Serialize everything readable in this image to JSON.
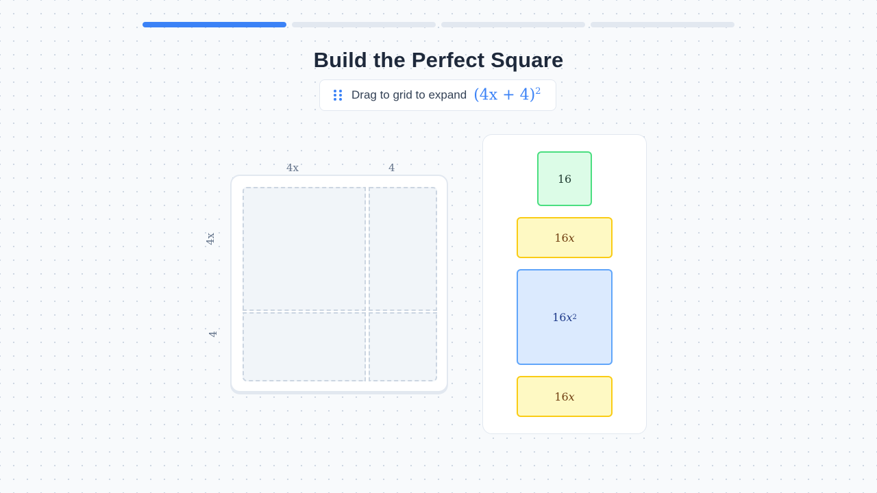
{
  "progress": {
    "total_steps": 4,
    "current_step": 1
  },
  "title": "Build the Perfect Square",
  "instruction": {
    "text": "Drag to grid to expand",
    "expression_base": "(4x + 4)",
    "expression_exponent": "2",
    "icon": "drag-handle-icon"
  },
  "grid": {
    "top_labels": [
      "4x",
      "4"
    ],
    "side_labels": [
      "4x",
      "4"
    ]
  },
  "tiles": [
    {
      "coefficient": "16",
      "variable": "",
      "exponent": "",
      "color": "green"
    },
    {
      "coefficient": "16",
      "variable": "x",
      "exponent": "",
      "color": "yellow"
    },
    {
      "coefficient": "16",
      "variable": "x",
      "exponent": "2",
      "color": "blue"
    },
    {
      "coefficient": "16",
      "variable": "x",
      "exponent": "",
      "color": "yellow"
    }
  ],
  "colors": {
    "accent": "#3b82f6",
    "constant_tile": "#dcfce7",
    "linear_tile": "#fef9c3",
    "square_tile": "#dbeafe"
  }
}
